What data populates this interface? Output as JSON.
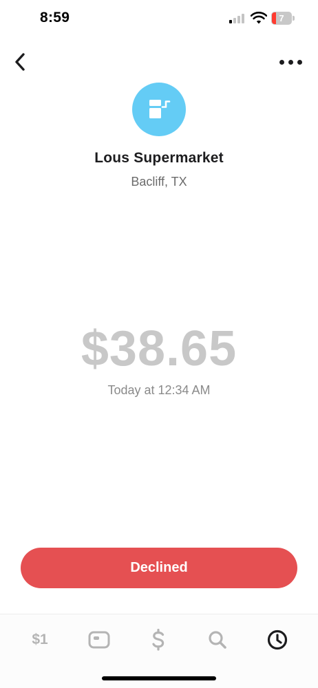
{
  "status_bar": {
    "time": "8:59",
    "battery_level": "7",
    "battery_color": "#ff3b30"
  },
  "nav": {
    "back_icon": "chevron-left-icon",
    "more_icon": "ellipsis-icon"
  },
  "merchant": {
    "icon": "storefront-icon",
    "avatar_color": "#64ccf5",
    "name": "Lous Supermarket",
    "location": "Bacliff, TX"
  },
  "transaction": {
    "amount": "$38.65",
    "timestamp": "Today at 12:34 AM",
    "status_label": "Declined",
    "status_color": "#e55052"
  },
  "tab_bar": {
    "money_label": "$1",
    "tabs": [
      {
        "icon": "money-tab-icon"
      },
      {
        "icon": "card-icon"
      },
      {
        "icon": "dollar-icon"
      },
      {
        "icon": "search-icon"
      },
      {
        "icon": "activity-clock-icon",
        "active": true
      }
    ]
  }
}
